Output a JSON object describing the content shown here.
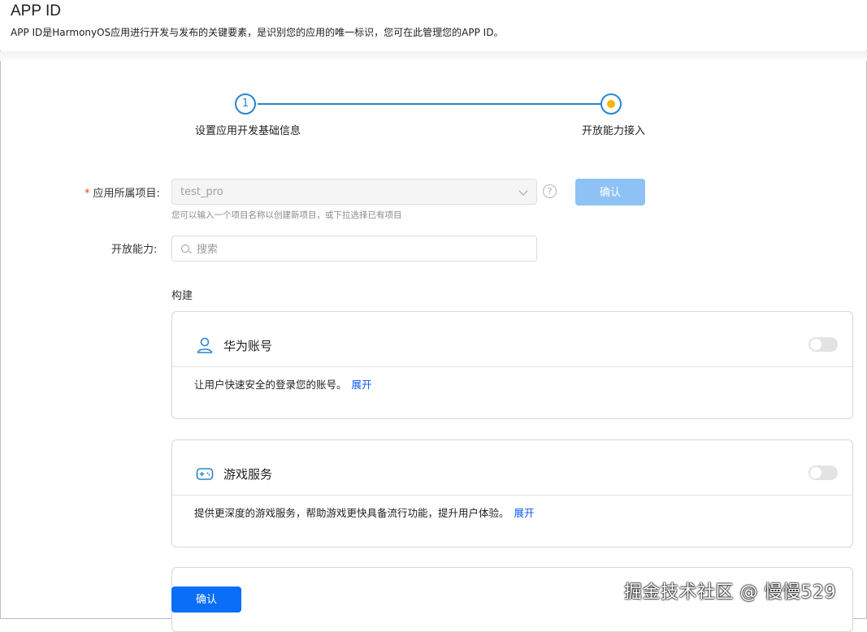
{
  "header": {
    "title": "APP ID",
    "description": "APP ID是HarmonyOS应用进行开发与发布的关键要素，是识别您的应用的唯一标识，您可在此管理您的APP ID。"
  },
  "steps": [
    {
      "number": "1",
      "label": "设置应用开发基础信息"
    },
    {
      "label": "开放能力接入"
    }
  ],
  "form": {
    "project_label": "应用所属项目:",
    "required_mark": "*",
    "project_value": "test_pro",
    "project_hint": "您可以输入一个项目名称以创建新项目，或下拉选择已有项目",
    "help_symbol": "?",
    "confirm_label": "确认",
    "ability_label": "开放能力:",
    "search_placeholder": "搜索"
  },
  "section": {
    "title": "构建"
  },
  "cards": [
    {
      "title": "华为账号",
      "description": "让用户快速安全的登录您的账号。",
      "expand": "展开",
      "icon": "user-icon",
      "enabled": false
    },
    {
      "title": "游戏服务",
      "description": "提供更深度的游戏服务，帮助游戏更快具备流行功能，提升用户体验。",
      "expand": "展开",
      "icon": "gamepad-icon",
      "enabled": false
    }
  ],
  "footer": {
    "confirm_label": "确认"
  },
  "watermark": "掘金技术社区 @ 慢慢529",
  "colors": {
    "accent": "#0a59f7",
    "step": "#2a86c8",
    "step_dot": "#f7b500",
    "required": "#e84026"
  }
}
